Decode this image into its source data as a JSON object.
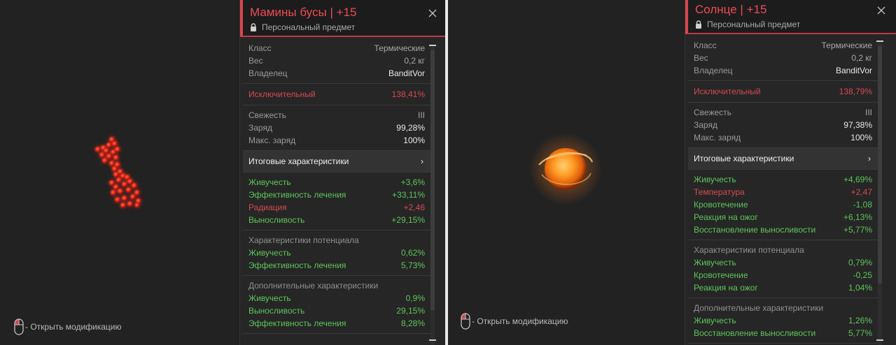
{
  "left": {
    "hint": "- Открыть модификацию",
    "title": "Мамины бусы",
    "sep": "|",
    "upgrade": "+15",
    "personal": "Персональный предмет",
    "info": [
      {
        "label": "Класс",
        "value": "Термические"
      },
      {
        "label": "Вес",
        "value": "0,2 кг"
      },
      {
        "label": "Владелец",
        "value": "BanditVor"
      }
    ],
    "exceptional": {
      "label": "Исключительный",
      "value": "138,41%"
    },
    "state": [
      {
        "label": "Свежесть",
        "value": "III"
      },
      {
        "label": "Заряд",
        "value": "99,28%"
      },
      {
        "label": "Макс. заряд",
        "value": "100%"
      }
    ],
    "summary_label": "Итоговые характеристики",
    "summary_arrow": "›",
    "totals": [
      {
        "label": "Живучесть",
        "value": "+3,6%",
        "color": "green"
      },
      {
        "label": "Эффективность лечения",
        "value": "+33,11%",
        "color": "green"
      },
      {
        "label": "Радиация",
        "value": "+2,46",
        "color": "red"
      },
      {
        "label": "Выносливость",
        "value": "+29,15%",
        "color": "green"
      }
    ],
    "potential_title": "Характеристики потенциала",
    "potential": [
      {
        "label": "Живучесть",
        "value": "0,62%"
      },
      {
        "label": "Эффективность лечения",
        "value": "5,73%"
      }
    ],
    "extra_title": "Дополнительные характеристики",
    "extra": [
      {
        "label": "Живучесть",
        "value": "0,9%"
      },
      {
        "label": "Выносливость",
        "value": "29,15%"
      },
      {
        "label": "Эффективность лечения",
        "value": "8,28%"
      }
    ]
  },
  "right": {
    "hint": "- Открыть модификацию",
    "title": "Солнце",
    "sep": "|",
    "upgrade": "+15",
    "personal": "Персональный предмет",
    "info": [
      {
        "label": "Класс",
        "value": "Термические"
      },
      {
        "label": "Вес",
        "value": "0,2 кг"
      },
      {
        "label": "Владелец",
        "value": "BanditVor"
      }
    ],
    "exceptional": {
      "label": "Исключительный",
      "value": "138,79%"
    },
    "state": [
      {
        "label": "Свежесть",
        "value": "III"
      },
      {
        "label": "Заряд",
        "value": "97,38%"
      },
      {
        "label": "Макс. заряд",
        "value": "100%"
      }
    ],
    "summary_label": "Итоговые характеристики",
    "summary_arrow": "›",
    "totals": [
      {
        "label": "Живучесть",
        "value": "+4,69%",
        "color": "green"
      },
      {
        "label": "Температура",
        "value": "+2,47",
        "color": "red"
      },
      {
        "label": "Кровотечение",
        "value": "-1,08",
        "color": "green"
      },
      {
        "label": "Реакция на ожог",
        "value": "+6,13%",
        "color": "green"
      },
      {
        "label": "Восстановление выносливости",
        "value": "+5,77%",
        "color": "green"
      }
    ],
    "potential_title": "Характеристики потенциала",
    "potential": [
      {
        "label": "Живучесть",
        "value": "0,79%"
      },
      {
        "label": "Кровотечение",
        "value": "-0,25"
      },
      {
        "label": "Реакция на ожог",
        "value": "1,04%"
      }
    ],
    "extra_title": "Дополнительные характеристики",
    "extra": [
      {
        "label": "Живучесть",
        "value": "1,26%"
      },
      {
        "label": "Восстановление выносливости",
        "value": "5,77%"
      }
    ]
  }
}
